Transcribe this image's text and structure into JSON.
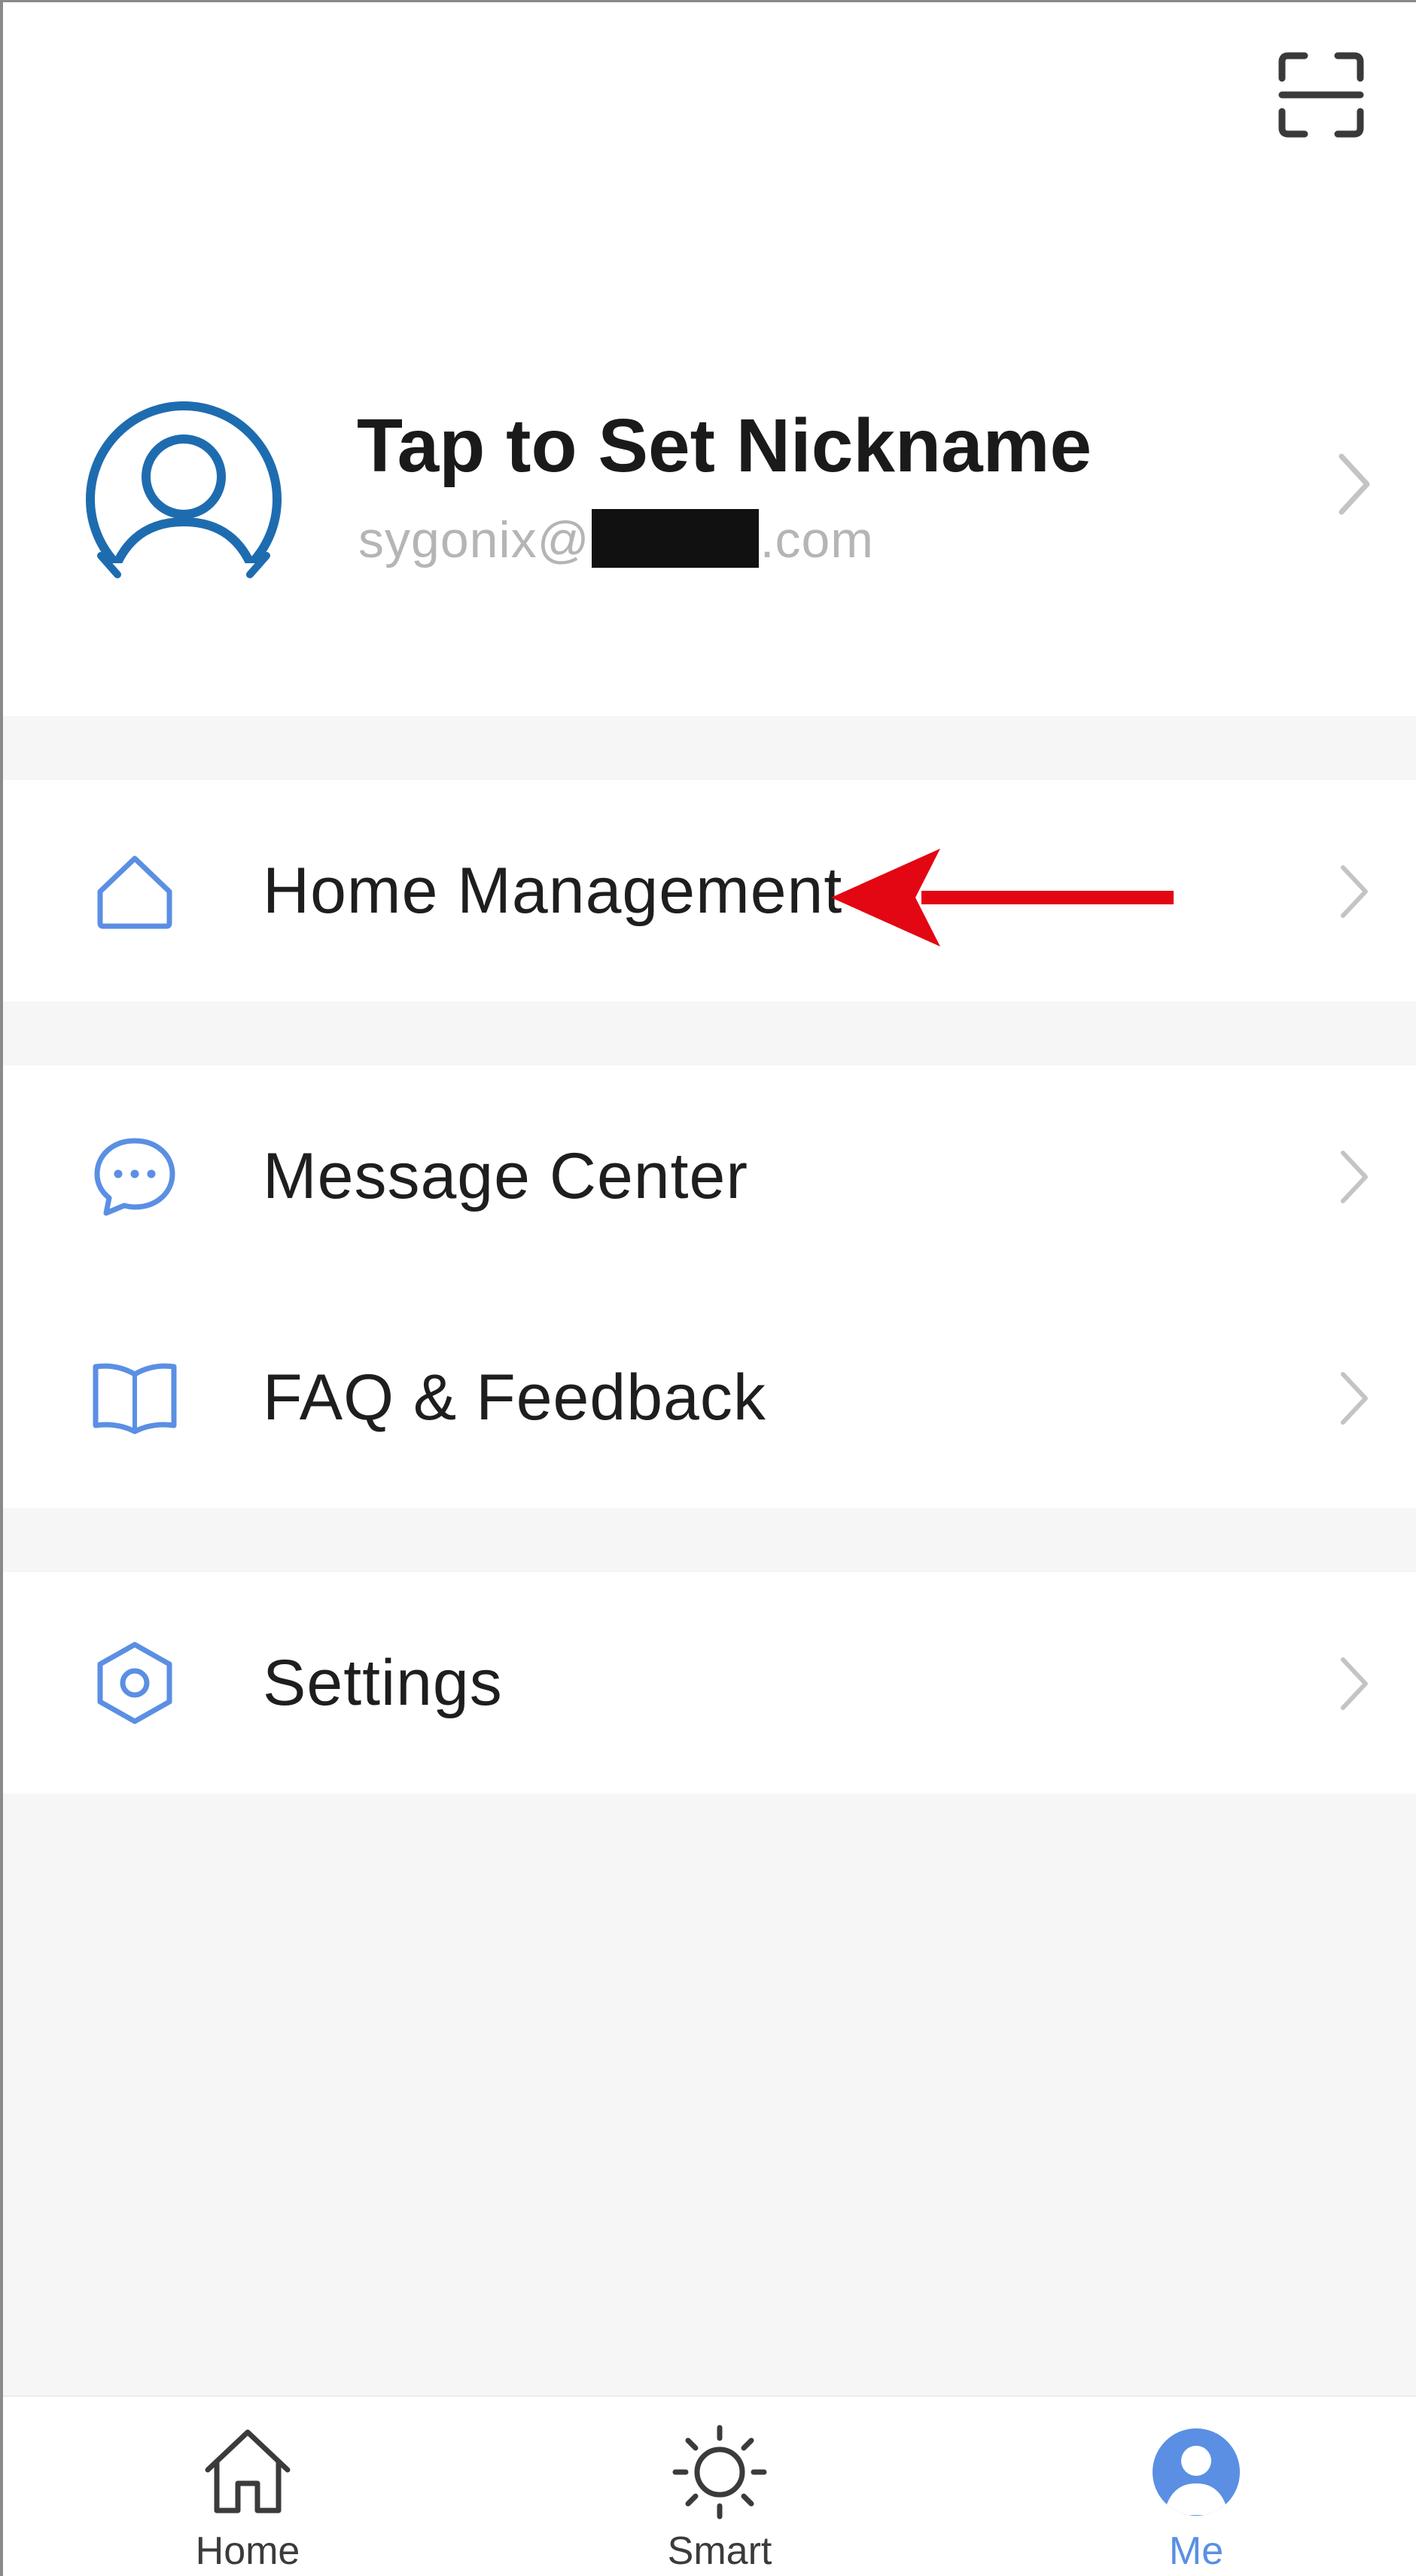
{
  "header": {
    "scan_icon": "scan-icon"
  },
  "profile": {
    "nickname": "Tap to Set Nickname",
    "email_prefix": "sygonix@",
    "email_suffix": ".com",
    "avatar_icon": "user-avatar-icon"
  },
  "menu": {
    "sections": [
      {
        "items": [
          {
            "label": "Home Management",
            "icon": "home-outline-icon"
          }
        ]
      },
      {
        "items": [
          {
            "label": "Message Center",
            "icon": "chat-bubble-icon"
          },
          {
            "label": "FAQ & Feedback",
            "icon": "book-icon"
          }
        ]
      },
      {
        "items": [
          {
            "label": "Settings",
            "icon": "hexagon-gear-icon"
          }
        ]
      }
    ]
  },
  "bottom_nav": {
    "tabs": [
      {
        "label": "Home",
        "icon": "home-icon",
        "active": false
      },
      {
        "label": "Smart",
        "icon": "sun-icon",
        "active": false
      },
      {
        "label": "Me",
        "icon": "profile-icon",
        "active": true
      }
    ]
  },
  "colors": {
    "accent_blue": "#5a8fe4",
    "avatar_blue": "#1e6cb0",
    "annotation_red": "#e30613",
    "background_gray": "#f6f6f6"
  }
}
